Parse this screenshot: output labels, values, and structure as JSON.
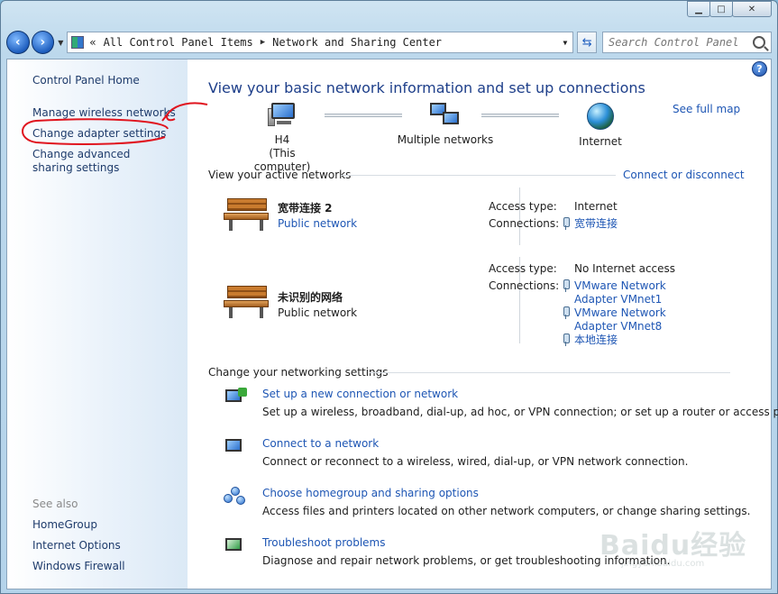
{
  "address": {
    "prefix": "«",
    "crumbs": [
      "All Control Panel Items",
      "Network and Sharing Center"
    ]
  },
  "search": {
    "placeholder": "Search Control Panel"
  },
  "sidebar": {
    "home": "Control Panel Home",
    "links": [
      "Manage wireless networks",
      "Change adapter settings",
      "Change advanced sharing settings"
    ],
    "see_also_label": "See also",
    "see_also": [
      "HomeGroup",
      "Internet Options",
      "Windows Firewall"
    ]
  },
  "main": {
    "title": "View your basic network information and set up connections",
    "see_full_map": "See full map",
    "map": {
      "computer_name": "H4",
      "computer_sub": "(This computer)",
      "middle": "Multiple networks",
      "internet": "Internet"
    },
    "active_label": "View your active networks",
    "connect_disconnect": "Connect or disconnect",
    "networks": [
      {
        "name": "宽带连接  2",
        "category": "Public network",
        "access_label": "Access type:",
        "access": "Internet",
        "connections_label": "Connections:",
        "connections": [
          "宽带连接"
        ]
      },
      {
        "name": "未识别的网络",
        "category": "Public network",
        "access_label": "Access type:",
        "access": "No Internet access",
        "connections_label": "Connections:",
        "connections": [
          "VMware Network Adapter VMnet1",
          "VMware Network Adapter VMnet8",
          "本地连接"
        ]
      }
    ],
    "settings_label": "Change your networking settings",
    "tasks": [
      {
        "title": "Set up a new connection or network",
        "desc": "Set up a wireless, broadband, dial-up, ad hoc, or VPN connection; or set up a router or access point."
      },
      {
        "title": "Connect to a network",
        "desc": "Connect or reconnect to a wireless, wired, dial-up, or VPN network connection."
      },
      {
        "title": "Choose homegroup and sharing options",
        "desc": "Access files and printers located on other network computers, or change sharing settings."
      },
      {
        "title": "Troubleshoot problems",
        "desc": "Diagnose and repair network problems, or get troubleshooting information."
      }
    ]
  },
  "watermark": {
    "text": "Baidu经验",
    "sub": "jingyan.baidu.com"
  },
  "colors": {
    "link": "#1e56b4",
    "annotation": "#e0141e"
  }
}
